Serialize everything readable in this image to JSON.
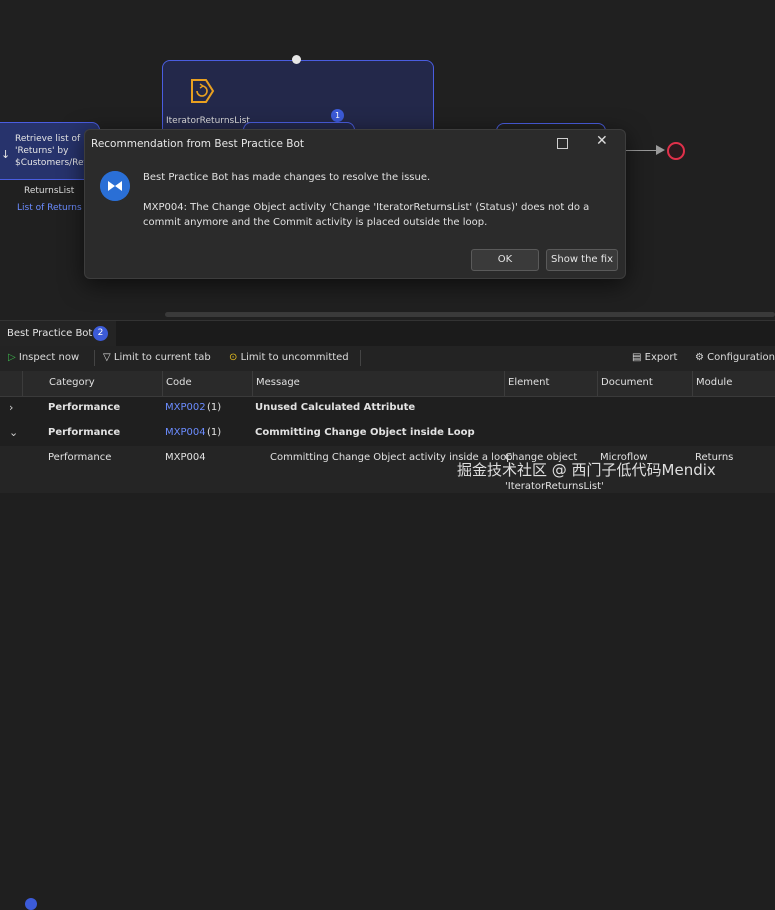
{
  "canvas": {
    "loop_label": "IteratorReturnsList",
    "retrieve_label": "Retrieve list of 'Returns' by $Customers/Retur",
    "var_name": "ReturnsList",
    "var_type": "List of Returns",
    "loop_badge": "1"
  },
  "dialog": {
    "title": "Recommendation from Best Practice Bot",
    "message_1": "Best Practice Bot has made changes to resolve the issue.",
    "message_2": "MXP004: The Change Object activity 'Change 'IteratorReturnsList' (Status)' does not do a commit anymore and the Commit activity is placed outside the loop.",
    "ok_label": "OK",
    "fix_label": "Show the fix"
  },
  "panel": {
    "tab_label": "Best Practice Bot",
    "tab_count": "2"
  },
  "toolbar": {
    "inspect": "Inspect now",
    "limit_tab": "Limit to current tab",
    "limit_uncommitted": "Limit to uncommitted",
    "export": "Export",
    "configuration": "Configuration"
  },
  "grid": {
    "headers": {
      "category": "Category",
      "code": "Code",
      "message": "Message",
      "element": "Element",
      "document": "Document",
      "module": "Module"
    },
    "group1": {
      "category": "Performance",
      "code": "MXP002",
      "count": "(1)",
      "message": "Unused Calculated Attribute"
    },
    "group2": {
      "category": "Performance",
      "code": "MXP004",
      "count": "(1)",
      "message": "Committing Change Object inside Loop"
    },
    "detail": {
      "category": "Performance",
      "code": "MXP004",
      "message": "Committing Change Object activity inside a loop",
      "element": "Change object",
      "element2": "'IteratorReturnsList'",
      "document": "Microflow",
      "module": "Returns"
    }
  },
  "watermark": "掘金技术社区 @ 西门子低代码Mendix",
  "colors": {
    "accent": "#3c5bd8",
    "link": "#6b8cff",
    "end_event": "#e0304a"
  }
}
